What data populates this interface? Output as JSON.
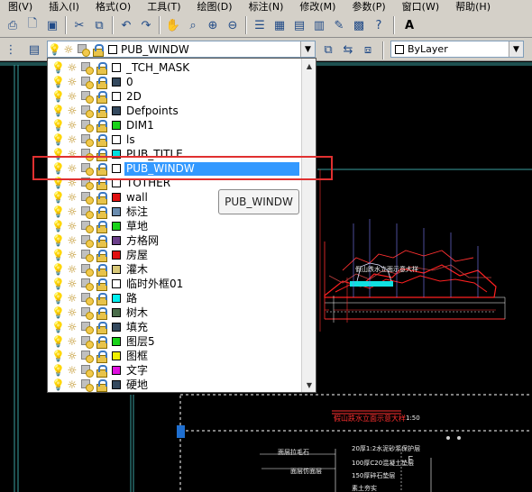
{
  "menubar": {
    "items": [
      "图(V)",
      "插入(I)",
      "格式(O)",
      "工具(T)",
      "绘图(D)",
      "标注(N)",
      "修改(M)",
      "参数(P)",
      "窗口(W)",
      "帮助(H)"
    ]
  },
  "layer_combo": {
    "current_layer": "PUB_WINDW",
    "current_color": "#ffffff"
  },
  "color_combo": {
    "value": "ByLayer"
  },
  "layers": [
    {
      "name": "_TCH_MASK",
      "color": "#ffffff"
    },
    {
      "name": "0",
      "color": "#34495e"
    },
    {
      "name": "2D",
      "color": "#ffffff"
    },
    {
      "name": "Defpoints",
      "color": "#34495e"
    },
    {
      "name": "DIM1",
      "color": "#19d219"
    },
    {
      "name": "ls",
      "color": "#ffffff"
    },
    {
      "name": "PUB_TITLE",
      "color": "#00e0e0"
    },
    {
      "name": "PUB_WINDW",
      "color": "#ffffff",
      "selected": true
    },
    {
      "name": "TOTHER",
      "color": "#ffffff"
    },
    {
      "name": "wall",
      "color": "#e01010"
    },
    {
      "name": "标注",
      "color": "#6a8caf"
    },
    {
      "name": "草地",
      "color": "#19d219"
    },
    {
      "name": "方格网",
      "color": "#6b3f8a"
    },
    {
      "name": "房屋",
      "color": "#e01010"
    },
    {
      "name": "灌木",
      "color": "#d8c878"
    },
    {
      "name": "临时外框01",
      "color": "#ffffff"
    },
    {
      "name": "路",
      "color": "#00f0f0"
    },
    {
      "name": "树木",
      "color": "#4a6d4a"
    },
    {
      "name": "填充",
      "color": "#34495e"
    },
    {
      "name": "图层5",
      "color": "#19d219"
    },
    {
      "name": "图框",
      "color": "#f0f000"
    },
    {
      "name": "文字",
      "color": "#e010e0"
    },
    {
      "name": "硬地",
      "color": "#34495e"
    }
  ],
  "tooltip": {
    "text": "PUB_WINDW"
  },
  "drawing": {
    "annotations": [
      "假山跌水立面示意大样",
      "1:50",
      "面层拉毛石",
      "面层仿面层",
      "20厚1:2水泥砂浆保护层",
      "100厚C20混凝土垫层",
      "150厚碎石垫层",
      "素土夯实"
    ],
    "watermark": "F"
  }
}
